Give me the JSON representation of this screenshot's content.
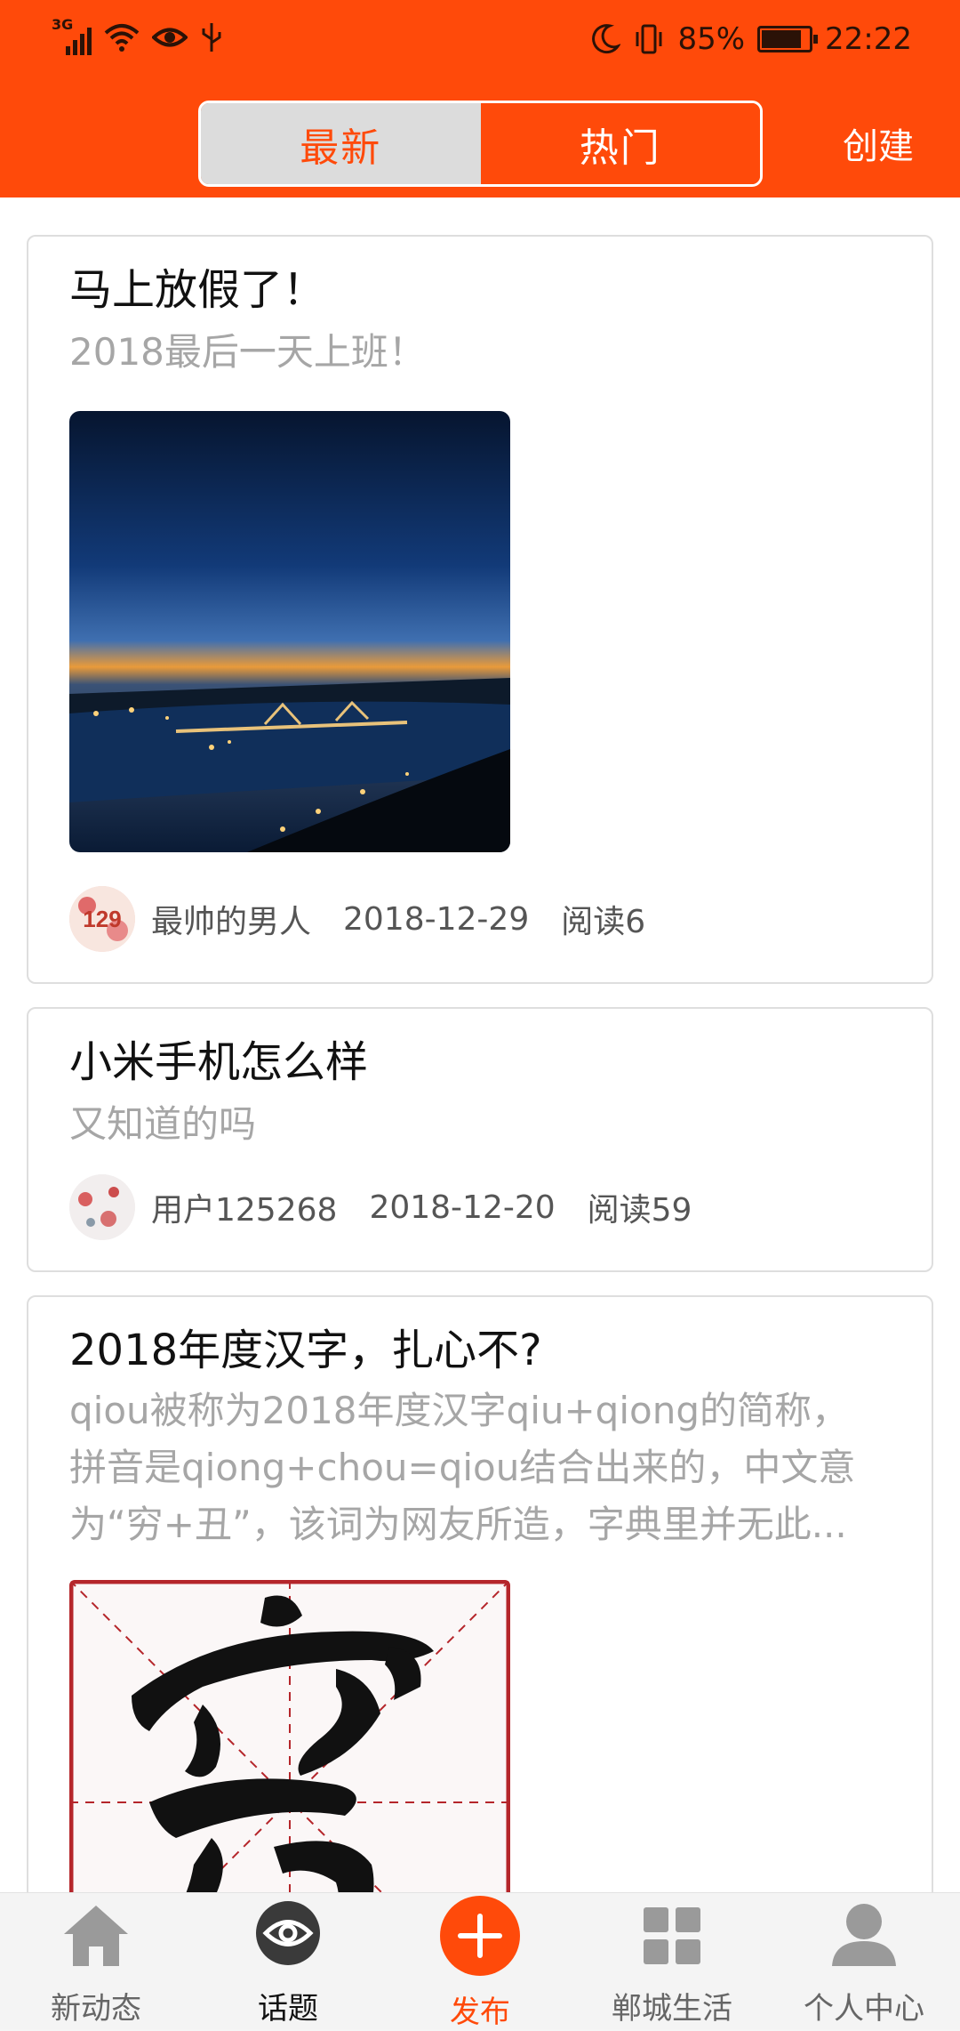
{
  "status_bar": {
    "network": "3G",
    "battery_percent": "85%",
    "battery_level": 0.85,
    "time": "22:22",
    "icons": [
      "signal-icon",
      "wifi-icon",
      "eye-icon",
      "usb-icon",
      "moon-icon",
      "vibrate-icon",
      "battery-icon"
    ]
  },
  "header": {
    "tabs": [
      {
        "label": "最新",
        "active": true
      },
      {
        "label": "热门",
        "active": false
      }
    ],
    "create_label": "创建",
    "accent_color": "#ff4a0a"
  },
  "feed": {
    "posts": [
      {
        "title": "马上放假了！",
        "summary": "2018最后一天上班！",
        "has_image": true,
        "image": "night-bridge-photo",
        "author": "最帅的男人",
        "date": "2018-12-29",
        "reads": "阅读6"
      },
      {
        "title": "小米手机怎么样",
        "summary": "又知道的吗",
        "has_image": false,
        "author": "用户125268",
        "date": "2018-12-20",
        "reads": "阅读59"
      },
      {
        "title": "2018年度汉字，扎心不?",
        "summary_lines": [
          "qiou被称为2018年度汉字qiu+qiong的简称，",
          "拼音是qiong+chou=qiou结合出来的，中文意",
          "为“穷+丑”，该词为网友所造，字典里并无此..."
        ],
        "has_image": true,
        "image": "calligraphy-character-image"
      }
    ]
  },
  "bottom_nav": {
    "items": [
      {
        "label": "新动态",
        "icon": "home-icon"
      },
      {
        "label": "话题",
        "icon": "eye-icon",
        "active": true
      },
      {
        "label": "发布",
        "icon": "plus-icon",
        "publish": true
      },
      {
        "label": "郸城生活",
        "icon": "grid-icon"
      },
      {
        "label": "个人中心",
        "icon": "user-icon"
      }
    ]
  }
}
